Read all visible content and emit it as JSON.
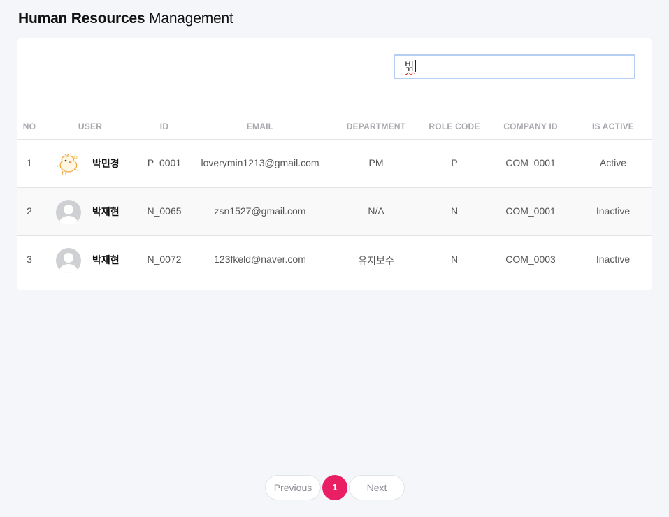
{
  "header": {
    "title_bold": "Human Resources",
    "title_rest": "Management"
  },
  "search": {
    "value": "밖"
  },
  "table": {
    "columns": [
      "NO",
      "USER",
      "ID",
      "EMAIL",
      "DEPARTMENT",
      "ROLE CODE",
      "COMPANY ID",
      "IS ACTIVE"
    ],
    "rows": [
      {
        "no": "1",
        "user": "박민경",
        "avatar": "bird-avatar-icon",
        "id": "P_0001",
        "email": "loverymin1213@gmail.com",
        "department": "PM",
        "role_code": "P",
        "company_id": "COM_0001",
        "is_active": "Active"
      },
      {
        "no": "2",
        "user": "박재현",
        "avatar": "default-avatar-icon",
        "id": "N_0065",
        "email": "zsn1527@gmail.com",
        "department": "N/A",
        "role_code": "N",
        "company_id": "COM_0001",
        "is_active": "Inactive"
      },
      {
        "no": "3",
        "user": "박재현",
        "avatar": "default-avatar-icon",
        "id": "N_0072",
        "email": "123fkeld@naver.com",
        "department": "유지보수",
        "role_code": "N",
        "company_id": "COM_0003",
        "is_active": "Inactive"
      }
    ]
  },
  "pagination": {
    "previous_label": "Previous",
    "current_page": "1",
    "next_label": "Next"
  },
  "colors": {
    "accent": "#e91e63",
    "background": "#f5f6fa",
    "search_border": "#b6cdf2"
  }
}
